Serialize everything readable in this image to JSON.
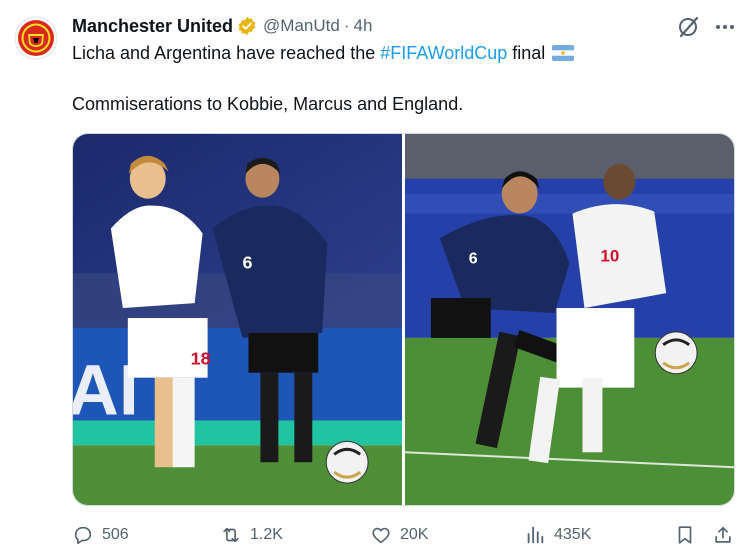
{
  "tweet": {
    "author_name": "Manchester United",
    "handle": "@ManUtd",
    "separator": "·",
    "time": "4h",
    "line1_prefix": "Licha and Argentina have reached the ",
    "hashtag": "#FIFAWorldCup",
    "line1_suffix": " final",
    "line2": "Commiserations to Kobbie, Marcus and England."
  },
  "players": {
    "left_england_number": "18",
    "left_argentina_number": "6",
    "right_argentina_number": "6",
    "right_england_number": "10"
  },
  "actions": {
    "replies": "506",
    "reposts": "1.2K",
    "likes": "20K",
    "views": "435K"
  },
  "colors": {
    "accent": "#1d9bf0",
    "muted": "#536471",
    "verified_gold": "#e8b40f",
    "man_utd_red": "#da291c"
  },
  "icons": [
    "man-utd-crest-icon",
    "verified-badge-icon",
    "grok-icon",
    "more-icon",
    "argentina-flag-icon",
    "reply-icon",
    "retweet-icon",
    "like-icon",
    "views-icon",
    "bookmark-icon",
    "share-icon"
  ]
}
